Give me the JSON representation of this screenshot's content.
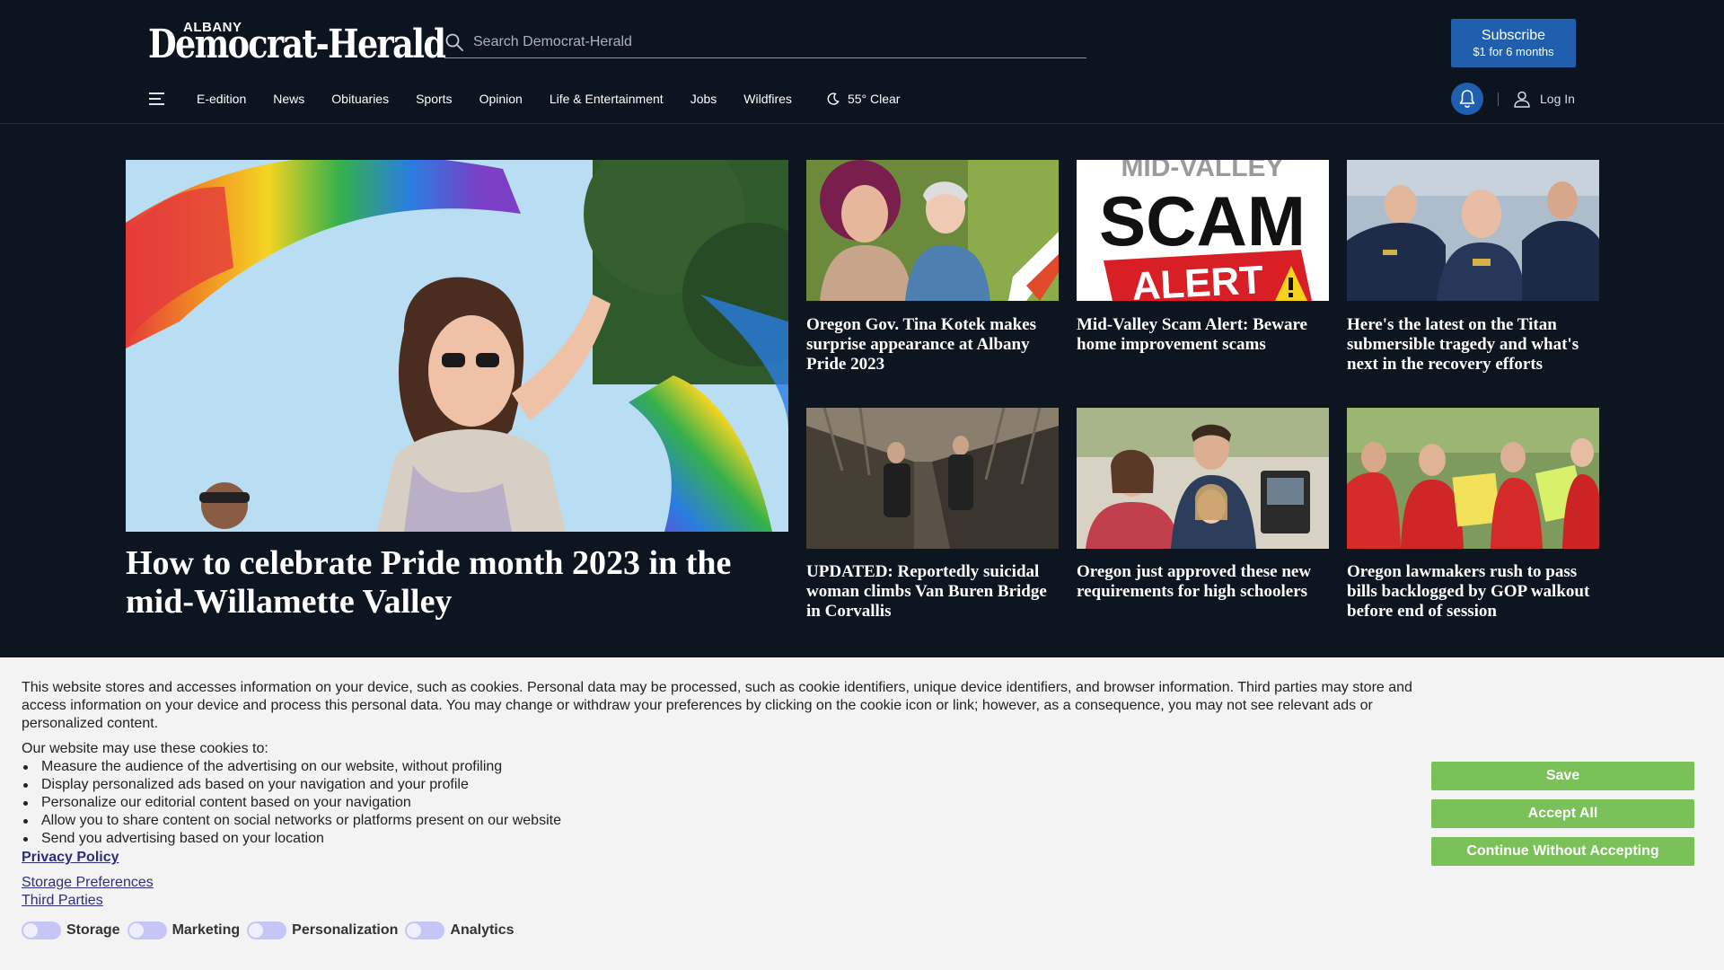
{
  "header": {
    "logo_small": "ALBANY",
    "logo_main": "Democrat-Herald",
    "search_placeholder": "Search Democrat-Herald",
    "subscribe_label": "Subscribe",
    "subscribe_sub": "$1 for 6 months",
    "login_label": "Log In",
    "accent_color": "#1f5fad"
  },
  "nav": {
    "items": [
      "E-edition",
      "News",
      "Obituaries",
      "Sports",
      "Opinion",
      "Life & Entertainment",
      "Jobs",
      "Wildfires"
    ],
    "weather": "55° Clear"
  },
  "hero": {
    "title": "How to celebrate Pride month 2023 in the mid-Willamette Valley"
  },
  "cards": [
    {
      "title": "Oregon Gov. Tina Kotek makes surprise appearance at Albany Pride 2023"
    },
    {
      "title": "Mid-Valley Scam Alert: Beware home improvement scams",
      "image_text_1": "MID-VALLEY",
      "image_text_2": "SCAM",
      "image_text_3": "ALERT"
    },
    {
      "title": "Here's the latest on the Titan submersible tragedy and what's next in the recovery efforts"
    },
    {
      "title": "UPDATED: Reportedly suicidal woman climbs Van Buren Bridge in Corvallis"
    },
    {
      "title": "Oregon just approved these new requirements for high schoolers"
    },
    {
      "title": "Oregon lawmakers rush to pass bills backlogged by GOP walkout before end of session"
    }
  ],
  "cookie": {
    "intro": "This website stores and accesses information on your device, such as cookies. Personal data may be processed, such as cookie identifiers, unique device identifiers, and browser information. Third parties may store and access information on your device and process this personal data. You may change or withdraw your preferences by clicking on the cookie icon or link; however, as a consequence, you may not see relevant ads or personalized content.",
    "uses_heading": "Our website may use these cookies to:",
    "uses": [
      "Measure the audience of the advertising on our website, without profiling",
      "Display personalized ads based on your navigation and your profile",
      "Personalize our editorial content based on your navigation",
      "Allow you to share content on social networks or platforms present on our website",
      "Send you advertising based on your location"
    ],
    "privacy_policy": "Privacy Policy",
    "storage_preferences": "Storage Preferences",
    "third_parties": "Third Parties",
    "toggles": [
      "Storage",
      "Marketing",
      "Personalization",
      "Analytics"
    ],
    "save_label": "Save",
    "accept_label": "Accept All",
    "continue_label": "Continue Without Accepting",
    "button_color": "#7ac15a"
  }
}
